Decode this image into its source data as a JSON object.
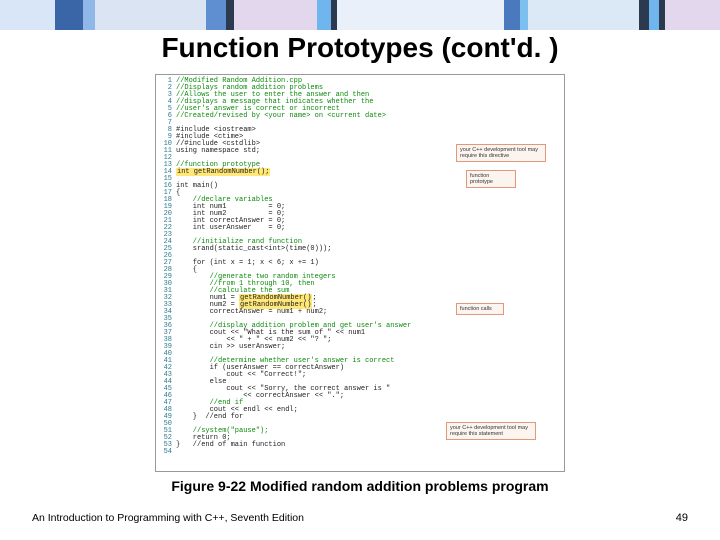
{
  "title": "Function Prototypes (cont'd. )",
  "caption": "Figure 9-22 Modified random addition problems program",
  "footer": {
    "left": "An Introduction to Programming with C++, Seventh Edition",
    "right": "49"
  },
  "callouts": {
    "proto": "function\nprototype",
    "dev1": "your C++ development\ntool may require this directive",
    "calls": "function calls",
    "dev2": "your C++ development\ntool may require this\nstatement"
  },
  "code": [
    {
      "n": 1,
      "c": "cmt",
      "t": "//Modified Random Addition.cpp"
    },
    {
      "n": 2,
      "c": "cmt",
      "t": "//Displays random addition problems"
    },
    {
      "n": 3,
      "c": "cmt",
      "t": "//Allows the user to enter the answer and then"
    },
    {
      "n": 4,
      "c": "cmt",
      "t": "//displays a message that indicates whether the"
    },
    {
      "n": 5,
      "c": "cmt",
      "t": "//user's answer is correct or incorrect"
    },
    {
      "n": 6,
      "c": "cmt",
      "t": "//Created/revised by <your name> on <current date>"
    },
    {
      "n": 7,
      "c": "norm",
      "t": ""
    },
    {
      "n": 8,
      "c": "norm",
      "t": "#include <iostream>"
    },
    {
      "n": 9,
      "c": "norm",
      "t": "#include <ctime>"
    },
    {
      "n": 10,
      "c": "norm",
      "t": "//#include <cstdlib>"
    },
    {
      "n": 11,
      "c": "norm",
      "t": "using namespace std;"
    },
    {
      "n": 12,
      "c": "norm",
      "t": ""
    },
    {
      "n": 13,
      "c": "cmt",
      "t": "//function prototype"
    },
    {
      "n": 14,
      "c": "hl",
      "t": "int getRandomNumber();"
    },
    {
      "n": 15,
      "c": "norm",
      "t": ""
    },
    {
      "n": 16,
      "c": "norm",
      "t": "int main()"
    },
    {
      "n": 17,
      "c": "norm",
      "t": "{"
    },
    {
      "n": 18,
      "c": "cmt",
      "t": "    //declare variables"
    },
    {
      "n": 19,
      "c": "norm",
      "t": "    int num1          = 0;"
    },
    {
      "n": 20,
      "c": "norm",
      "t": "    int num2          = 0;"
    },
    {
      "n": 21,
      "c": "norm",
      "t": "    int correctAnswer = 0;"
    },
    {
      "n": 22,
      "c": "norm",
      "t": "    int userAnswer    = 0;"
    },
    {
      "n": 23,
      "c": "norm",
      "t": ""
    },
    {
      "n": 24,
      "c": "cmt",
      "t": "    //initialize rand function"
    },
    {
      "n": 25,
      "c": "norm",
      "t": "    srand(static_cast<int>(time(0)));"
    },
    {
      "n": 26,
      "c": "norm",
      "t": ""
    },
    {
      "n": 27,
      "c": "norm",
      "t": "    for (int x = 1; x < 6; x += 1)"
    },
    {
      "n": 28,
      "c": "norm",
      "t": "    {"
    },
    {
      "n": 29,
      "c": "cmt",
      "t": "        //generate two random integers"
    },
    {
      "n": 30,
      "c": "cmt",
      "t": "        //from 1 through 10, then"
    },
    {
      "n": 31,
      "c": "cmt",
      "t": "        //calculate the sum"
    },
    {
      "n": 32,
      "c": "mix",
      "t": "        num1 = ",
      "hl": "getRandomNumber()",
      "t2": ";"
    },
    {
      "n": 33,
      "c": "mix",
      "t": "        num2 = ",
      "hl": "getRandomNumber()",
      "t2": ";"
    },
    {
      "n": 34,
      "c": "norm",
      "t": "        correctAnswer = num1 + num2;"
    },
    {
      "n": 35,
      "c": "norm",
      "t": ""
    },
    {
      "n": 36,
      "c": "cmt",
      "t": "        //display addition problem and get user's answer"
    },
    {
      "n": 37,
      "c": "norm",
      "t": "        cout << \"What is the sum of \" << num1"
    },
    {
      "n": 38,
      "c": "norm",
      "t": "            << \" + \" << num2 << \"? \";"
    },
    {
      "n": 39,
      "c": "norm",
      "t": "        cin >> userAnswer;"
    },
    {
      "n": 40,
      "c": "norm",
      "t": ""
    },
    {
      "n": 41,
      "c": "cmt",
      "t": "        //determine whether user's answer is correct"
    },
    {
      "n": 42,
      "c": "norm",
      "t": "        if (userAnswer == correctAnswer)"
    },
    {
      "n": 43,
      "c": "norm",
      "t": "            cout << \"Correct!\";"
    },
    {
      "n": 44,
      "c": "norm",
      "t": "        else"
    },
    {
      "n": 45,
      "c": "norm",
      "t": "            cout << \"Sorry, the correct answer is \""
    },
    {
      "n": 46,
      "c": "norm",
      "t": "                << correctAnswer << \".\";"
    },
    {
      "n": 47,
      "c": "cmt",
      "t": "        //end if"
    },
    {
      "n": 48,
      "c": "norm",
      "t": "        cout << endl << endl;"
    },
    {
      "n": 49,
      "c": "norm",
      "t": "    }  //end for"
    },
    {
      "n": 50,
      "c": "norm",
      "t": ""
    },
    {
      "n": 51,
      "c": "cmt",
      "t": "    //system(\"pause\");"
    },
    {
      "n": 52,
      "c": "norm",
      "t": "    return 0;"
    },
    {
      "n": 53,
      "c": "norm",
      "t": "}   //end of main function"
    },
    {
      "n": 54,
      "c": "norm",
      "t": ""
    }
  ]
}
